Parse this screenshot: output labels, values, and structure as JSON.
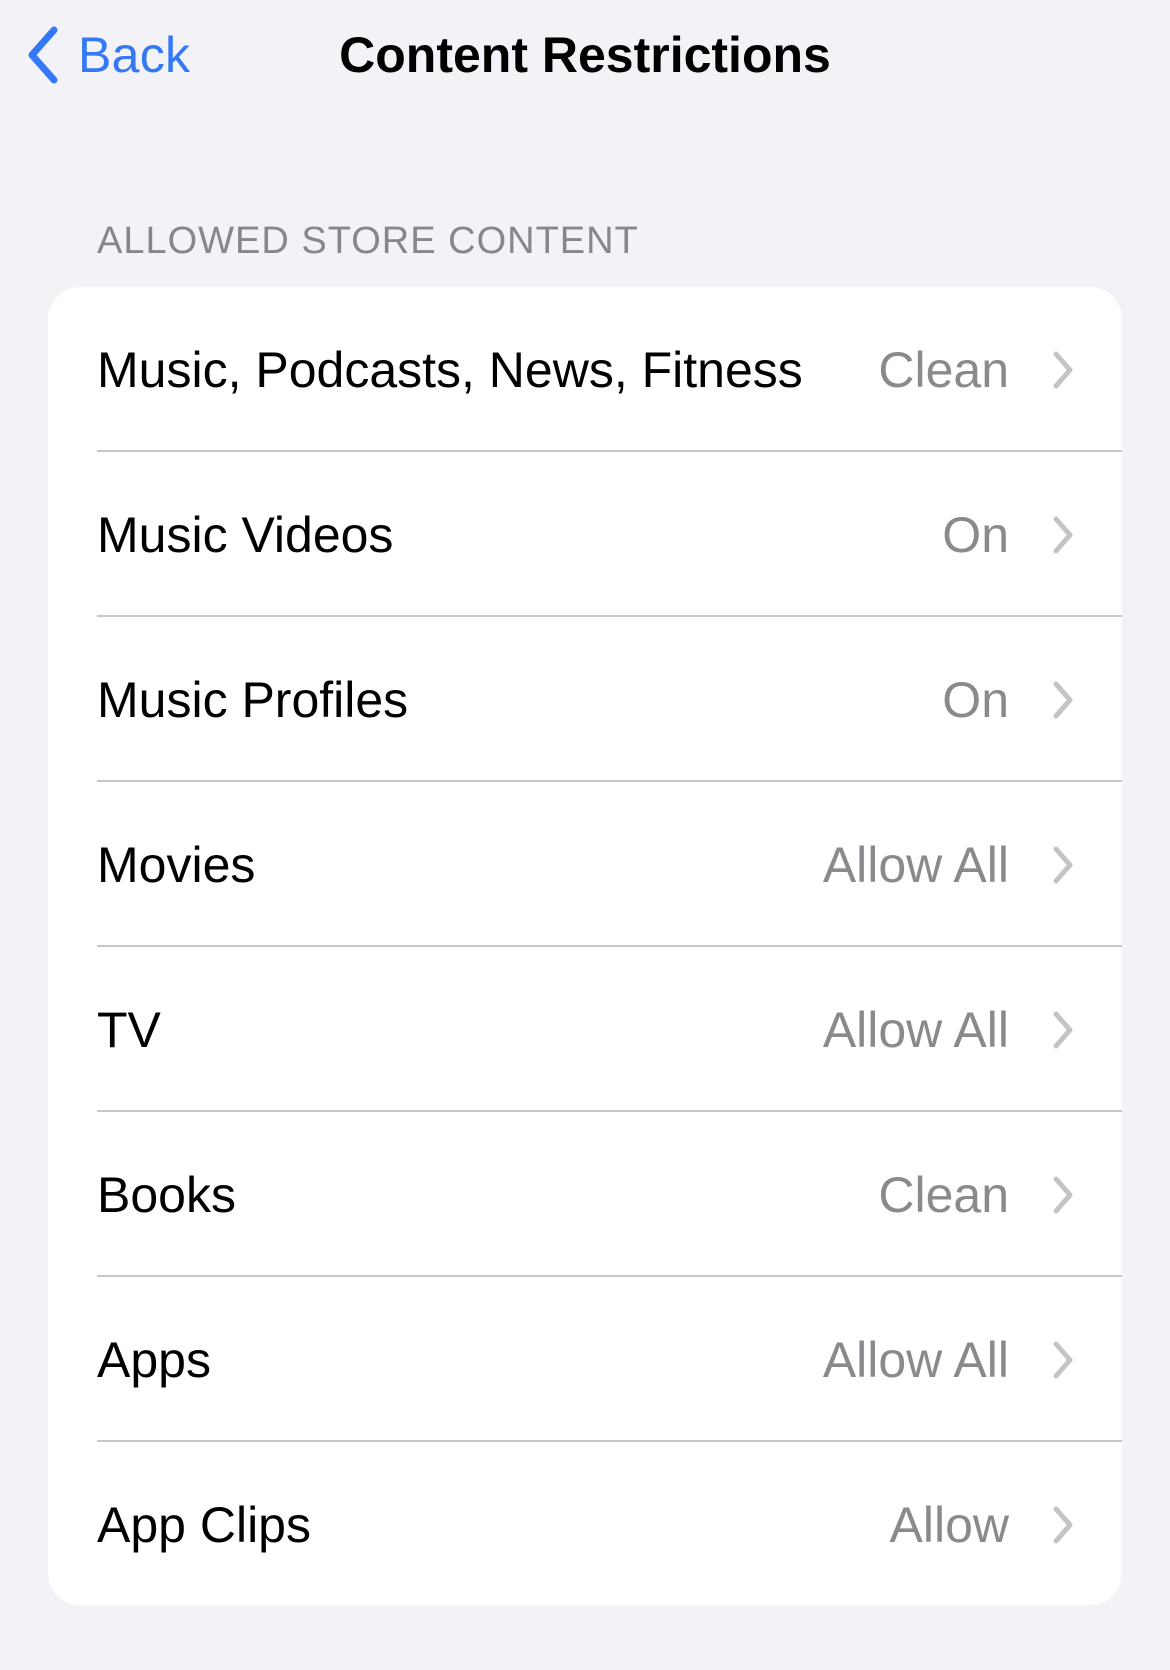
{
  "nav": {
    "back_label": "Back",
    "title": "Content Restrictions"
  },
  "section": {
    "header": "ALLOWED STORE CONTENT",
    "rows": [
      {
        "label": "Music, Podcasts, News, Fitness",
        "value": "Clean"
      },
      {
        "label": "Music Videos",
        "value": "On"
      },
      {
        "label": "Music Profiles",
        "value": "On"
      },
      {
        "label": "Movies",
        "value": "Allow All"
      },
      {
        "label": "TV",
        "value": "Allow All"
      },
      {
        "label": "Books",
        "value": "Clean"
      },
      {
        "label": "Apps",
        "value": "Allow All"
      },
      {
        "label": "App Clips",
        "value": "Allow"
      }
    ]
  },
  "colors": {
    "accent": "#3478f6",
    "background": "#f2f2f7",
    "secondary_text": "#8a8a8e"
  }
}
